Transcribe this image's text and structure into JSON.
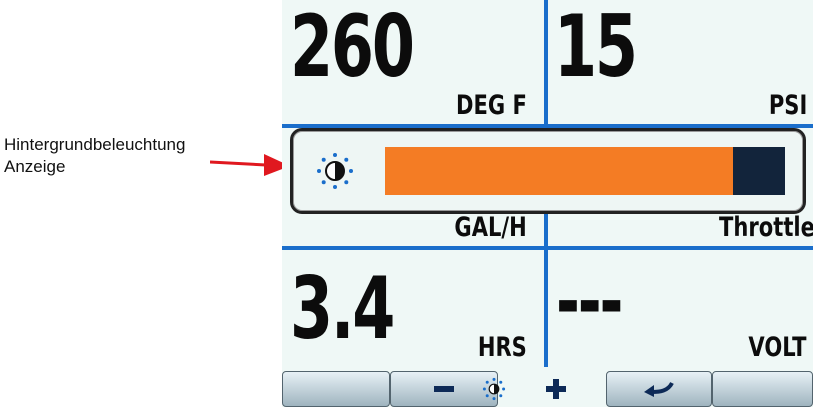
{
  "callout": {
    "line1": "Hintergrundbeleuchtung",
    "line2": "Anzeige"
  },
  "gauges": [
    {
      "value": "260",
      "unit": "DEG F"
    },
    {
      "value": "15",
      "unit": "PSI"
    },
    {
      "value": "",
      "unit": "GAL/H"
    },
    {
      "value": "",
      "unit": "Throttle"
    },
    {
      "value": "3.4",
      "unit": "HRS"
    },
    {
      "value": "---",
      "unit": "VOLT"
    }
  ],
  "backlight": {
    "icon": "brightness-icon",
    "level_percent": 87,
    "fill_color": "#f47c24",
    "track_color": "#12243b"
  },
  "softkeys": [
    {
      "icon": ""
    },
    {
      "icon": "minus-icon"
    },
    {
      "icon": "brightness-icon"
    },
    {
      "icon": "plus-icon"
    },
    {
      "icon": "back-arrow-icon"
    },
    {
      "icon": ""
    }
  ],
  "colors": {
    "grid_line": "#1a6ecb",
    "screen_bg": "#eff8f6",
    "callout_arrow": "#e0181f"
  }
}
